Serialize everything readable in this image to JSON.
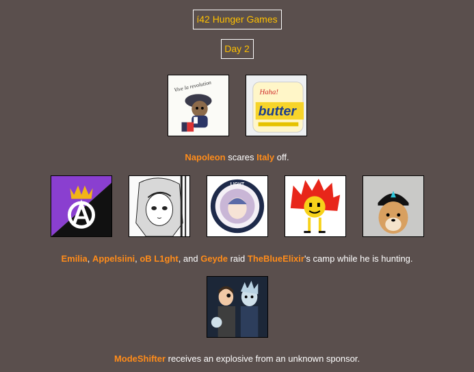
{
  "header": {
    "title": "í42 Hunger Games",
    "day": "Day 2"
  },
  "events": [
    {
      "parts": {
        "n1": "Napoleon",
        "t1": " scares ",
        "n2": "Italy",
        "t2": " off."
      },
      "avatars": [
        "napoleon-avatar",
        "italy-avatar"
      ]
    },
    {
      "parts": {
        "n1": "Emilia",
        "t1": ", ",
        "n2": "Appelsiini",
        "t2": ", ",
        "n3": "oB L1ght",
        "t3": ", and ",
        "n4": "Geyde",
        "t4": " raid ",
        "n5": "TheBlueElixir",
        "t5": "'s camp while he is hunting."
      },
      "avatars": [
        "emilia-avatar",
        "appelsiini-avatar",
        "ob-l1ght-avatar",
        "geyde-avatar",
        "theblueelixir-avatar"
      ]
    },
    {
      "parts": {
        "n1": "ModeShifter",
        "t1": " receives an explosive from an unknown sponsor."
      },
      "avatars": [
        "modeshifter-avatar"
      ]
    }
  ],
  "avatar_art": {
    "napoleon_caption": "Vive la revolution",
    "italy_caption_1": "Haha!",
    "italy_caption_2": "butter"
  },
  "colors": {
    "background": "#5a4f4d",
    "accent_box_text": "#ffc000",
    "name_color": "#ff8c1a",
    "text": "#ffffff"
  }
}
